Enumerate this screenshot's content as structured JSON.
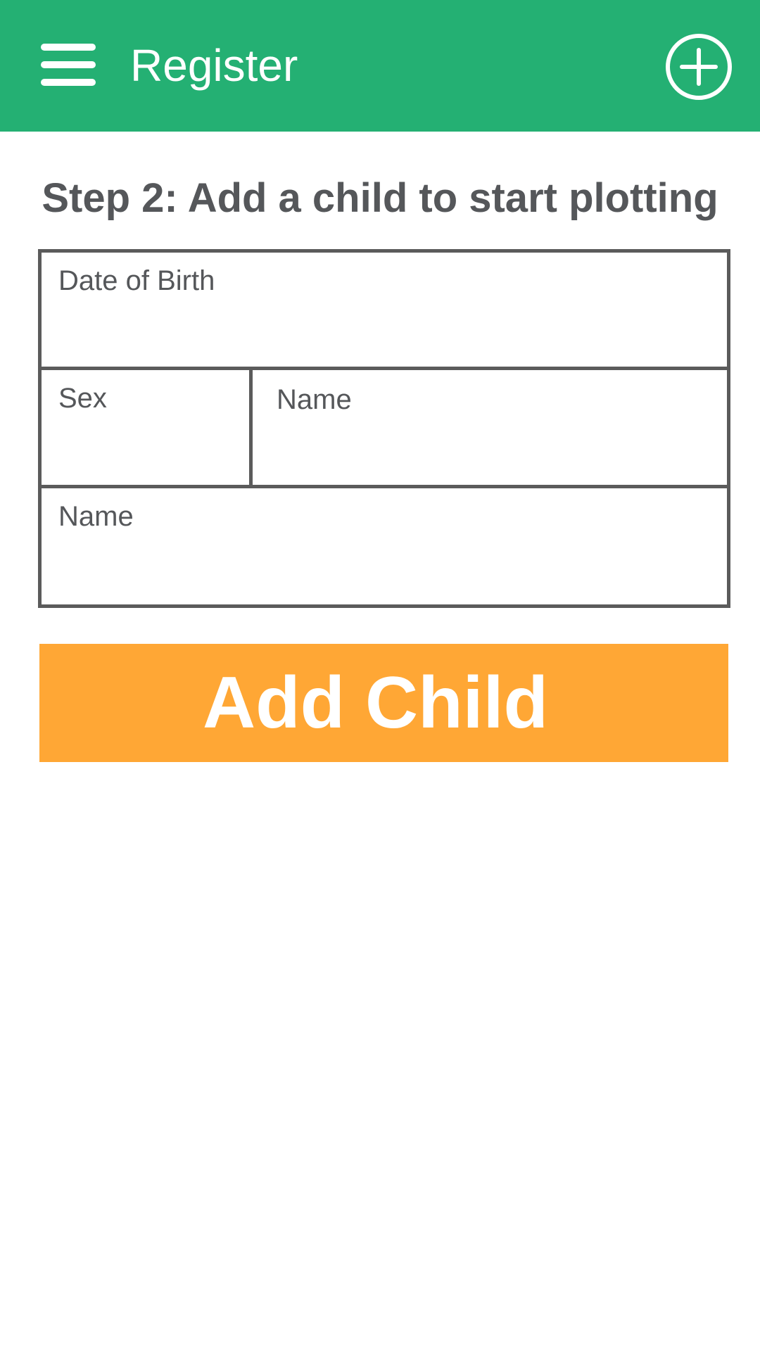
{
  "app_bar": {
    "title": "Register",
    "background_color": "#24b073",
    "menu_icon": "hamburger-menu-icon",
    "add_icon": "plus-circle-icon"
  },
  "form": {
    "heading": "Step 2: Add a child to start plotting",
    "fields": {
      "date_of_birth": {
        "label": "Date of Birth",
        "value": ""
      },
      "sex": {
        "label": "Sex",
        "value": ""
      },
      "name_primary": {
        "label": "Name",
        "value": ""
      },
      "name_secondary": {
        "label": "Name",
        "value": ""
      }
    },
    "submit_label": "Add Child",
    "submit_color": "#ffa735"
  }
}
